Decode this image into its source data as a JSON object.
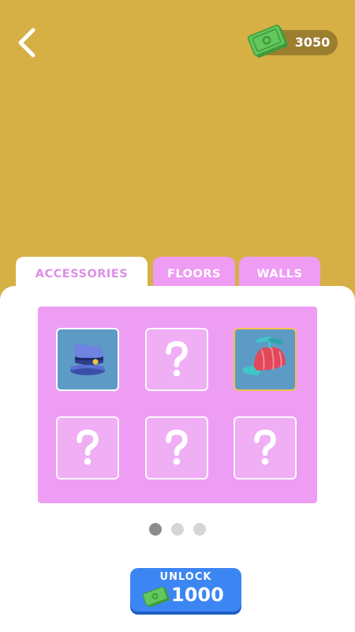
{
  "header": {
    "back_icon": "chevron-left-icon",
    "currency": {
      "icon": "cash-icon",
      "amount": "3050"
    }
  },
  "tabs": [
    {
      "label": "ACCESSORIES",
      "active": true
    },
    {
      "label": "FLOORS",
      "active": false
    },
    {
      "label": "WALLS",
      "active": false
    }
  ],
  "grid": {
    "items": [
      {
        "state": "owned",
        "icon": "police-cap-icon"
      },
      {
        "state": "locked",
        "icon": "question-mark-icon"
      },
      {
        "state": "selected",
        "icon": "propeller-cap-icon"
      },
      {
        "state": "locked",
        "icon": "question-mark-icon"
      },
      {
        "state": "locked",
        "icon": "question-mark-icon"
      },
      {
        "state": "locked",
        "icon": "question-mark-icon"
      }
    ]
  },
  "pagination": {
    "pages": 3,
    "current": 1
  },
  "unlock_button": {
    "label": "UNLOCK",
    "price": "1000",
    "icon": "cash-icon"
  },
  "colors": {
    "background": "#d6b045",
    "tab_active_text": "#dc8fe6",
    "tab_inactive_bg": "#ee9cf4",
    "grid_bg": "#ed9df3",
    "slot_owned_bg": "#5e9ac6",
    "selected_border": "#f2c24a",
    "button_blue": "#3c86f4",
    "cash_green": "#5fc35a",
    "dot_active": "#8c8c8c",
    "dot_inactive": "#d6d6d6"
  }
}
